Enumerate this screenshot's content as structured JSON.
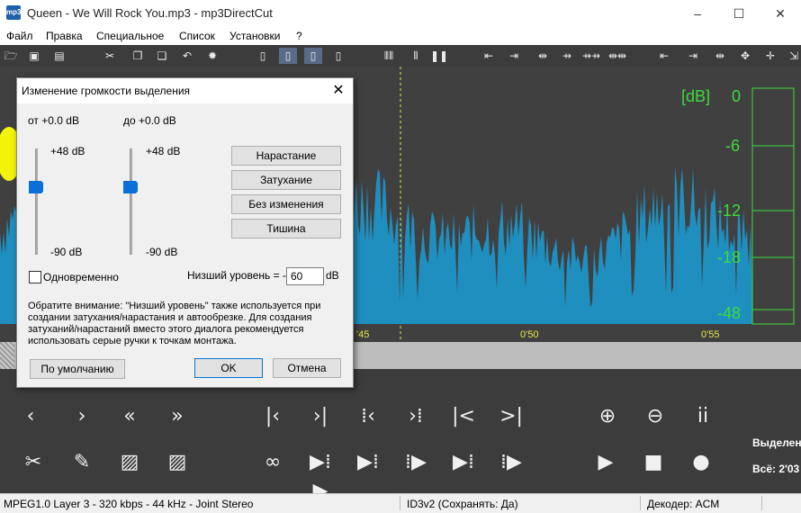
{
  "window": {
    "title": "Queen - We Will Rock You.mp3 - mp3DirectCut",
    "icon_label": "mp3",
    "minimize": "–",
    "maximize": "☐",
    "close": "✕"
  },
  "menu": [
    "Файл",
    "Правка",
    "Специальное",
    "Список",
    "Установки",
    "?"
  ],
  "toolbar_icons": [
    "open-icon",
    "save-icon",
    "save-split-icon",
    "cut-icon",
    "copy-icon",
    "paste-icon",
    "undo-icon",
    "settings-icon",
    "page-icon",
    "page-selected-icon",
    "page-edit-icon",
    "page-info-icon",
    "barcode-icon",
    "pause-bars-icon",
    "set-cue-icons"
  ],
  "waveform": {
    "db_unit": "[dB]",
    "db_scale": [
      "0",
      "-6",
      "-12",
      "-18",
      "-48"
    ],
    "timeline": [
      "'45",
      "0'50",
      "0'55"
    ],
    "wave_color": "#1f8fc0",
    "meter_color": "#3bdc3b"
  },
  "controls": {
    "row1": [
      "‹",
      "›",
      "«",
      "»",
      "|‹",
      "›|",
      "⁞‹",
      "›⁞",
      "|<",
      ">|"
    ],
    "row2_labels": [
      "cut",
      "pencil",
      "fade-in",
      "fade-out",
      "loop",
      "play-selection",
      "play-to-cut",
      "play-from-cut",
      "play-end",
      "play-start"
    ],
    "transport": [
      "▶",
      "■",
      "●"
    ],
    "zoom_in": "zoom-in-icon",
    "zoom_out": "zoom-out-icon",
    "info": "info-icon",
    "selection_label": "Выделен",
    "total_label": "Всё: 2'03"
  },
  "status": {
    "format": "MPEG1.0 Layer 3 - 320 kbps - 44 kHz - Joint Stereo",
    "tag": "ID3v2 (Сохранять: Да)",
    "decoder": "Декодер: ACM"
  },
  "dialog": {
    "title": "Изменение громкости выделения",
    "from_label": "от +0.0 dB",
    "to_label": "до +0.0 dB",
    "max_left": "+48 dB",
    "min_left": "-90 dB",
    "max_right": "+48 dB",
    "min_right": "-90 dB",
    "btn_fade_in": "Нарастание",
    "btn_fade_out": "Затухание",
    "btn_no_change": "Без изменения",
    "btn_silence": "Тишина",
    "simultaneous": "Одновременно",
    "low_level_label": "Низший уровень = -",
    "low_level_value": "60",
    "db_unit": "dB",
    "note": "Обратите внимание: \"Низший уровень\" также используется при создании затухания/нарастания и автообрезке. Для создания затуханий/нарастаний вместо этого диалога рекомендуется использовать серые ручки к точкам монтажа.",
    "btn_default": "По умолчанию",
    "btn_ok": "OK",
    "btn_cancel": "Отмена"
  }
}
